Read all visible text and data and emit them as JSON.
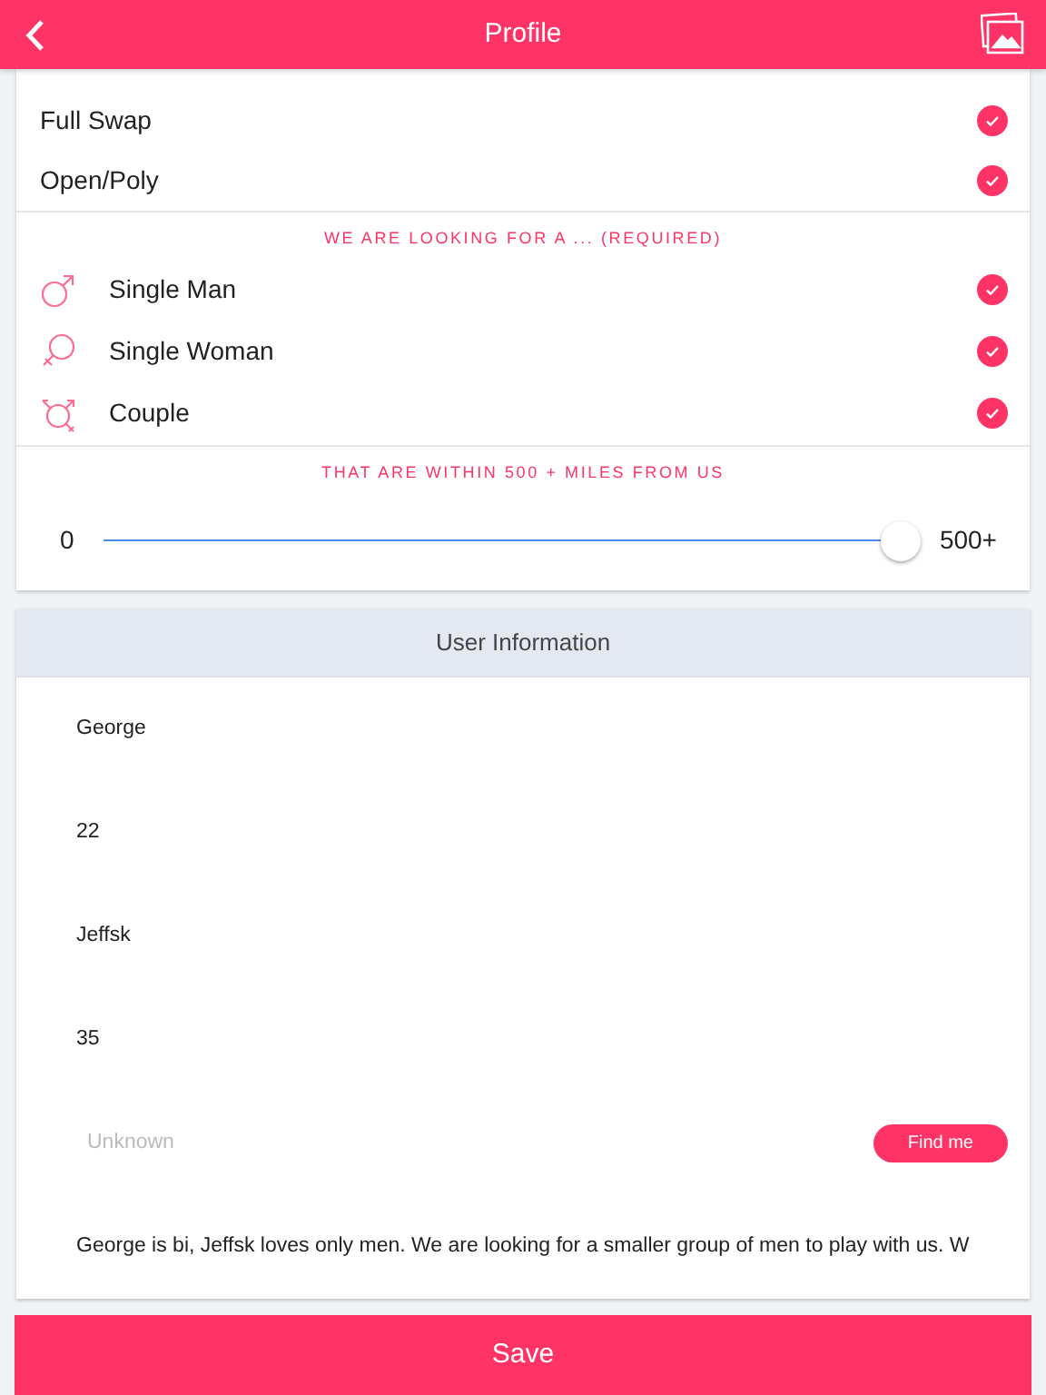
{
  "header": {
    "title": "Profile"
  },
  "options": [
    {
      "label": "Full Swap",
      "checked": true
    },
    {
      "label": "Open/Poly",
      "checked": true
    }
  ],
  "looking_for": {
    "heading": "WE ARE LOOKING FOR A ... (REQUIRED)",
    "items": [
      {
        "kind": "man",
        "label": "Single Man",
        "checked": true
      },
      {
        "kind": "woman",
        "label": "Single Woman",
        "checked": true
      },
      {
        "kind": "couple",
        "label": "Couple",
        "checked": true
      }
    ]
  },
  "distance": {
    "heading": "THAT ARE WITHIN 500 + MILES FROM US",
    "min_label": "0",
    "max_label": "500+",
    "level": 1
  },
  "user_information": {
    "title": "User Information",
    "fields": [
      {
        "kind": "text",
        "value": "George"
      },
      {
        "kind": "text",
        "value": "22"
      },
      {
        "kind": "text",
        "value": "Jeffsk"
      },
      {
        "kind": "text",
        "value": "35"
      },
      {
        "kind": "location",
        "placeholder": "Unknown",
        "button": "Find me"
      },
      {
        "kind": "text",
        "value": "George is bi, Jeffsk loves only men. We are looking for a smaller group of men to play with us. W"
      }
    ]
  },
  "save_button": "Save"
}
